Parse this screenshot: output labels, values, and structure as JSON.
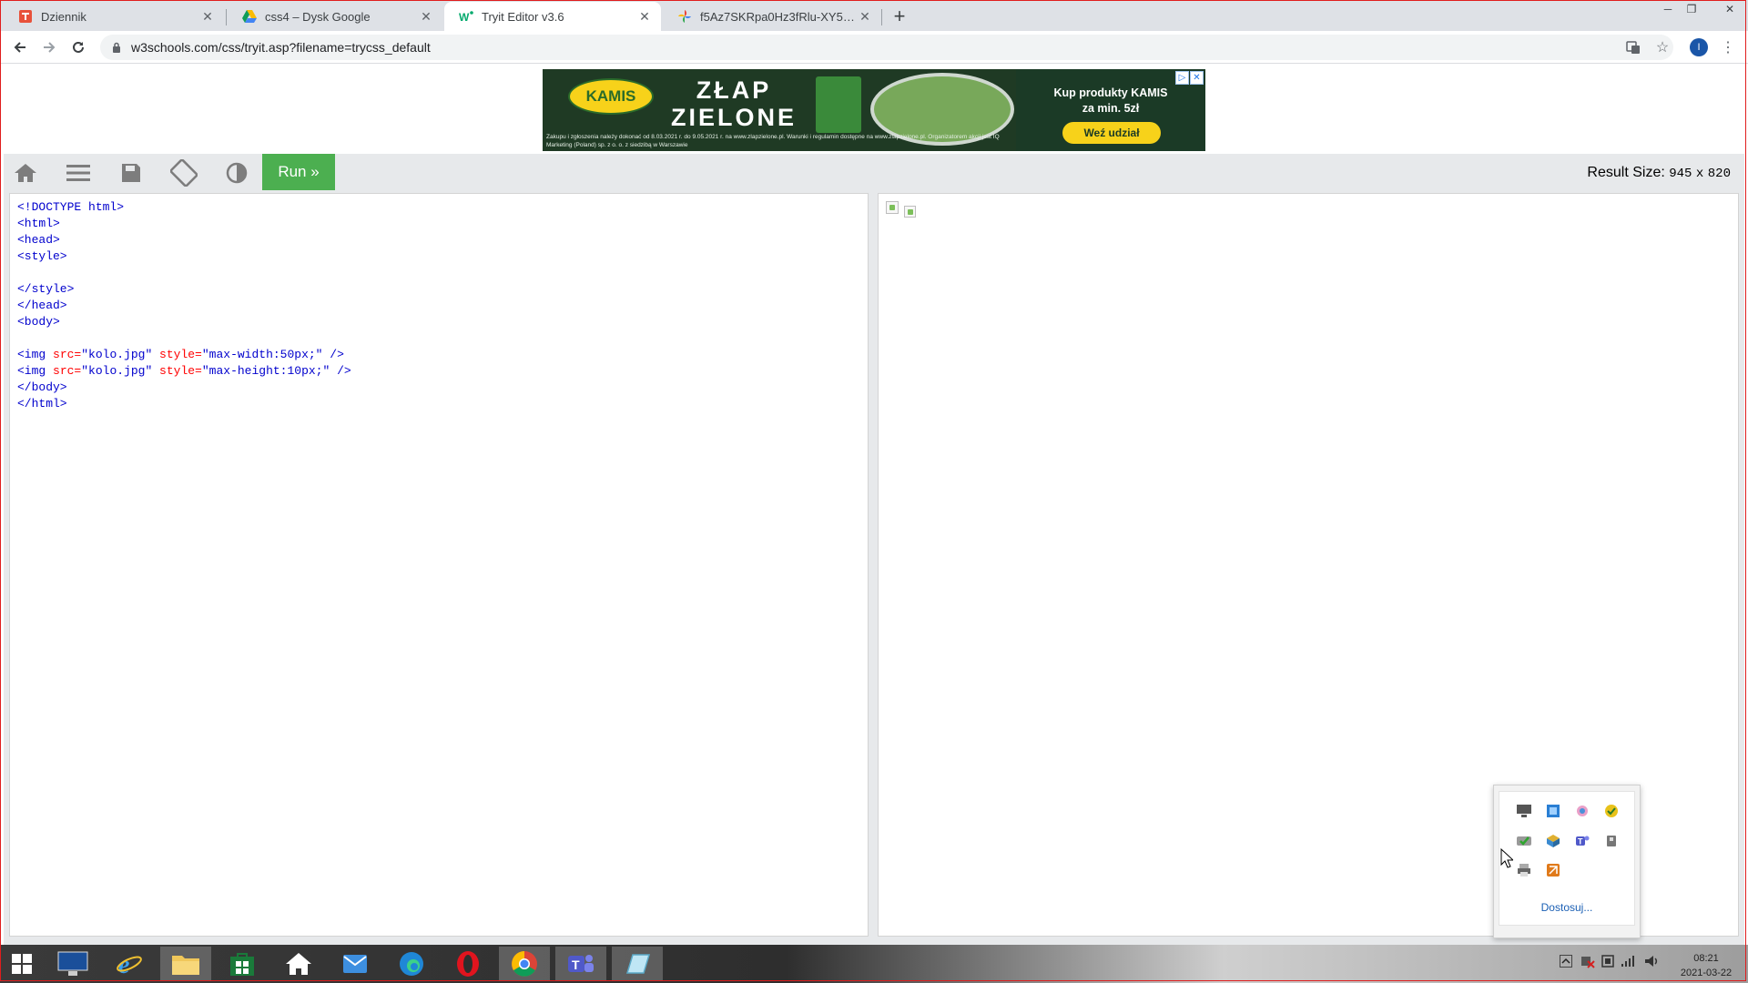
{
  "browser": {
    "tabs": [
      {
        "title": "Dziennik",
        "favicon": "dziennik-icon",
        "active": false
      },
      {
        "title": "css4 – Dysk Google",
        "favicon": "google-drive-icon",
        "active": false
      },
      {
        "title": "Tryit Editor v3.6",
        "favicon": "w3schools-icon",
        "active": true
      },
      {
        "title": "f5Az7SKRpa0Hz3fRlu-XY5ezMm",
        "favicon": "google-photos-icon",
        "active": false
      }
    ],
    "url": "w3schools.com/css/tryit.asp?filename=trycss_default",
    "profile_initial": "I"
  },
  "ad": {
    "brand": "KAMIS",
    "headline_line1": "ZŁAP",
    "headline_line2": "ZIELONE",
    "cta_text_line1": "Kup produkty KAMIS",
    "cta_text_line2": "za min. 5zł",
    "cta_button": "Weź udział",
    "fine_print": "Zakupu i zgłoszenia należy dokonać od 8.03.2021 r. do 9.05.2021 r. na www.zlapzielone.pl. Warunki i regulamin dostępne na www.zlapzielone.pl. Organizatorem akcji jest IQ Marketing (Poland) sp. z o. o. z siedzibą w Warszawie"
  },
  "w3bar": {
    "run_label": "Run »",
    "result_size_label": "Result Size:",
    "result_width": "945",
    "result_x": "x",
    "result_height": "820"
  },
  "code": {
    "doctype": "<!DOCTYPE html>",
    "html_open": "<html>",
    "head_open": "<head>",
    "style_open": "<style>",
    "style_close": "</style>",
    "head_close": "</head>",
    "body_open": "<body>",
    "img1_open": "<img ",
    "img1_src_attr": "src=",
    "img1_src_val": "\"kolo.jpg\"",
    "img1_style_attr": " style=",
    "img1_style_val": "\"max-width:50px;\"",
    "img1_close": " />",
    "img2_open": "<img ",
    "img2_src_attr": "src=",
    "img2_src_val": "\"kolo.jpg\"",
    "img2_style_attr": " style=",
    "img2_style_val": "\"max-height:10px;\"",
    "img2_close": " />",
    "body_close": "</body>",
    "html_close": "</html>"
  },
  "tray_popup": {
    "customize_label": "Dostosuj..."
  },
  "taskbar": {
    "time": "08:21",
    "date": "2021-03-22"
  },
  "colors": {
    "run_green": "#4caf50",
    "code_tag": "#0000cd",
    "code_attr": "#ff0000",
    "window_border": "#e01d1d"
  }
}
